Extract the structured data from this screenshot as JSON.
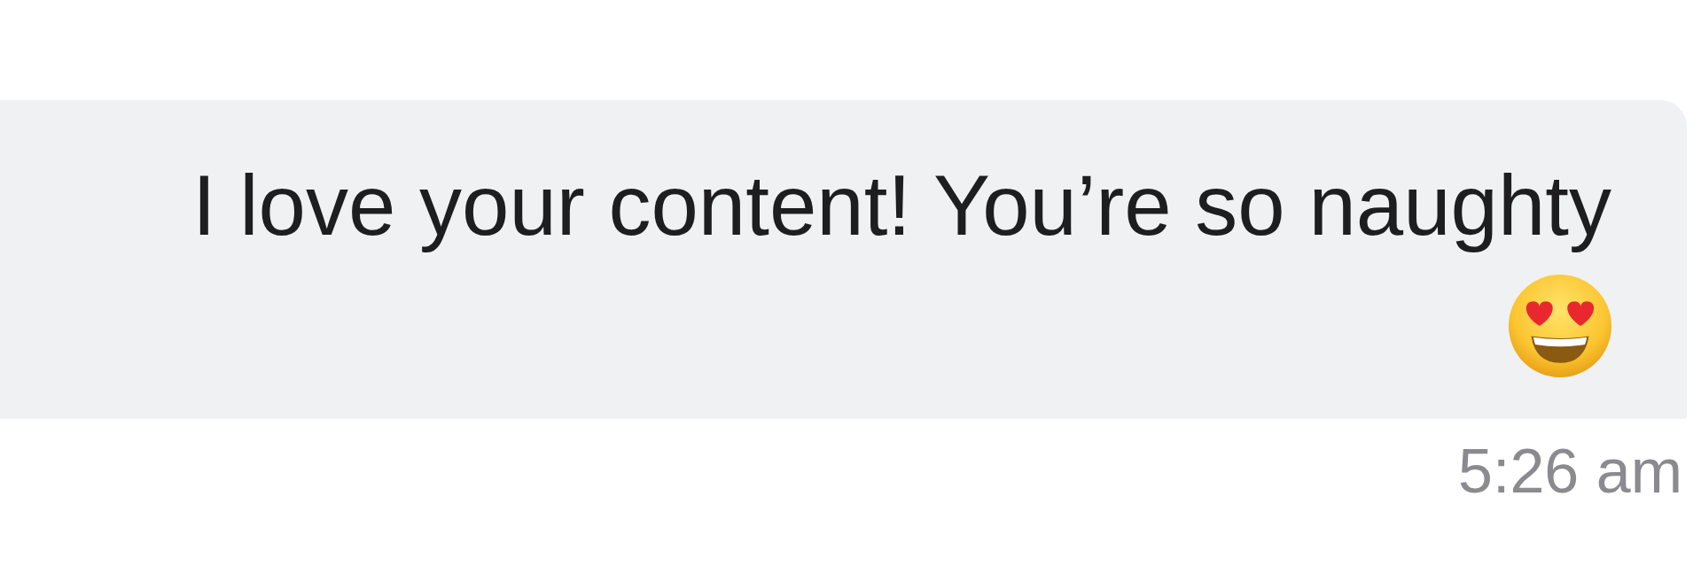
{
  "message": {
    "text": "I love your content! You’re so naughty",
    "time": "5:26 am"
  }
}
